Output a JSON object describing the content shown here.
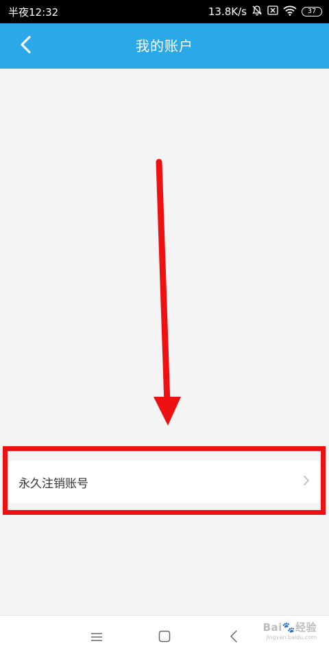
{
  "status_bar": {
    "time": "半夜12:32",
    "net_speed": "13.8K/s",
    "battery": "37",
    "icons": [
      "mute-bell-icon",
      "sim-off-icon",
      "wifi-icon",
      "battery-icon"
    ]
  },
  "header": {
    "title": "我的账户",
    "background": "#2aa8e8",
    "back_icon": "chevron-left-icon"
  },
  "list": {
    "items": [
      {
        "label": "永久注销账号",
        "icon": "chevron-right-icon"
      }
    ]
  },
  "annotation": {
    "arrow_color": "#ee1111",
    "highlight_color": "#ee1111"
  },
  "nav_bar": {
    "icons": [
      "menu-icon",
      "home-square-icon",
      "back-triangle-icon"
    ]
  },
  "watermark": {
    "logo": "Bai🐾经验",
    "sub": "jingyan.baidu.com"
  }
}
